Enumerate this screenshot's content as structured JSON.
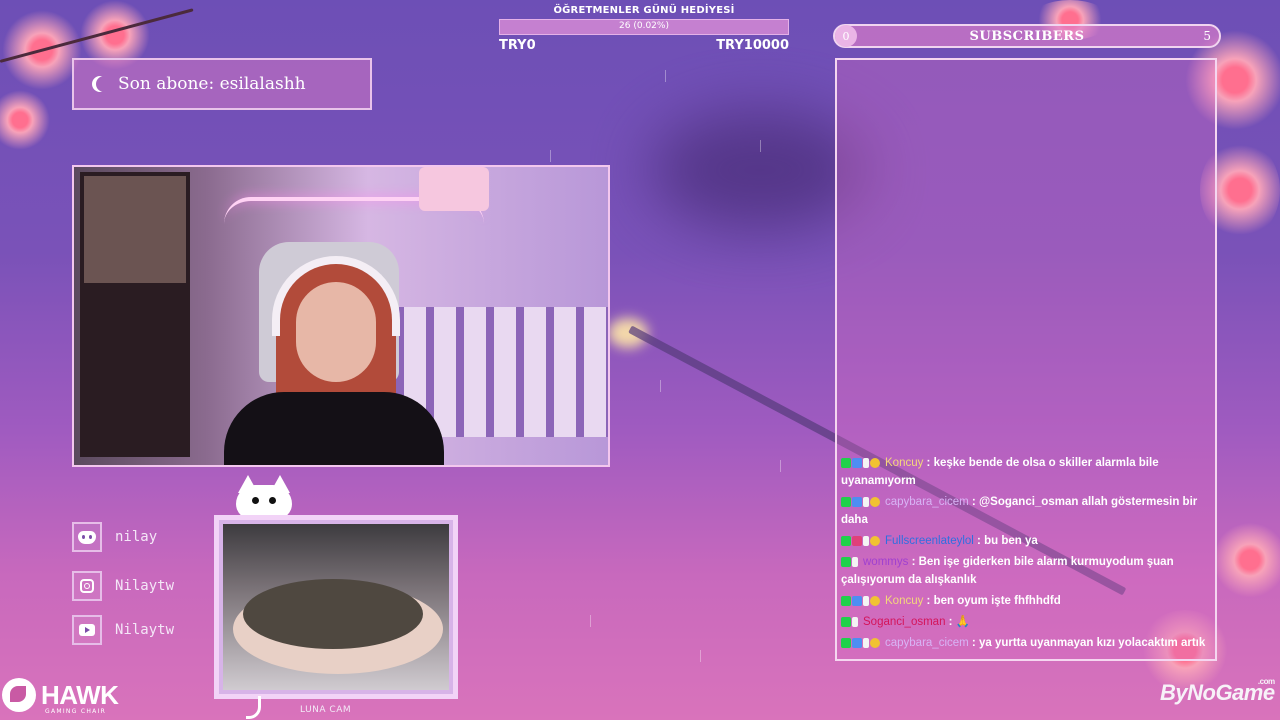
{
  "donation": {
    "title": "ÖĞRETMENLER GÜNÜ HEDİYESİ",
    "progress_text": "26 (0.02%)",
    "progress_fraction": 0.0002,
    "min": "TRY0",
    "max": "TRY10000"
  },
  "latest_sub": {
    "text": "Son abone: esilalashh"
  },
  "subscribers": {
    "current": "0",
    "label": "SUBSCRIBERS",
    "goal": "5"
  },
  "socials": [
    {
      "icon": "discord-icon",
      "label": "nilay"
    },
    {
      "icon": "instagram-icon",
      "label": "Nilaytw"
    },
    {
      "icon": "youtube-icon",
      "label": "Nilaytw"
    }
  ],
  "cam2_caption": "LUNA CAM",
  "chat": [
    {
      "user": "Koncuy",
      "user_color": "#f3d77a",
      "badges": [
        "b-k",
        "b-s",
        "b-w",
        "b-g"
      ],
      "text": "keşke bende de olsa o skiller alarmla bile uyanamıyorm"
    },
    {
      "user": "capybara_cicem",
      "user_color": "#d8b4f5",
      "badges": [
        "b-k",
        "b-s",
        "b-w",
        "b-g"
      ],
      "text": "@Soganci_osman allah göstermesin bir daha"
    },
    {
      "user": "Fullscreenlateylol",
      "user_color": "#2f6fe0",
      "badges": [
        "b-k",
        "b-m",
        "b-w",
        "b-g"
      ],
      "text": "bu ben ya"
    },
    {
      "user": "wommys",
      "user_color": "#a040d0",
      "badges": [
        "b-k",
        "b-w"
      ],
      "text": "Ben işe giderken bile alarm kurmuyodum şuan çalışıyorum da alışkanlık"
    },
    {
      "user": "Koncuy",
      "user_color": "#f3d77a",
      "badges": [
        "b-k",
        "b-s",
        "b-w",
        "b-g"
      ],
      "text": "ben oyum işte fhfhhdfd"
    },
    {
      "user": "Soganci_osman",
      "user_color": "#d4145a",
      "badges": [
        "b-k",
        "b-w"
      ],
      "text": "🙏"
    },
    {
      "user": "capybara_cicem",
      "user_color": "#d8b4f5",
      "badges": [
        "b-k",
        "b-s",
        "b-w",
        "b-g"
      ],
      "text": "ya yurtta uyanmayan kızı yolacaktım artık"
    }
  ],
  "logos": {
    "hawk": "HAWK",
    "hawk_sub": "GAMING CHAIR",
    "bynogame": "ByNoGame",
    "bynogame_suffix": ".com"
  },
  "colors": {
    "frame": "#f5d6f0",
    "accent": "#d86fc0",
    "bg_top": "#6d4fb6",
    "bg_bottom": "#d973bb"
  }
}
